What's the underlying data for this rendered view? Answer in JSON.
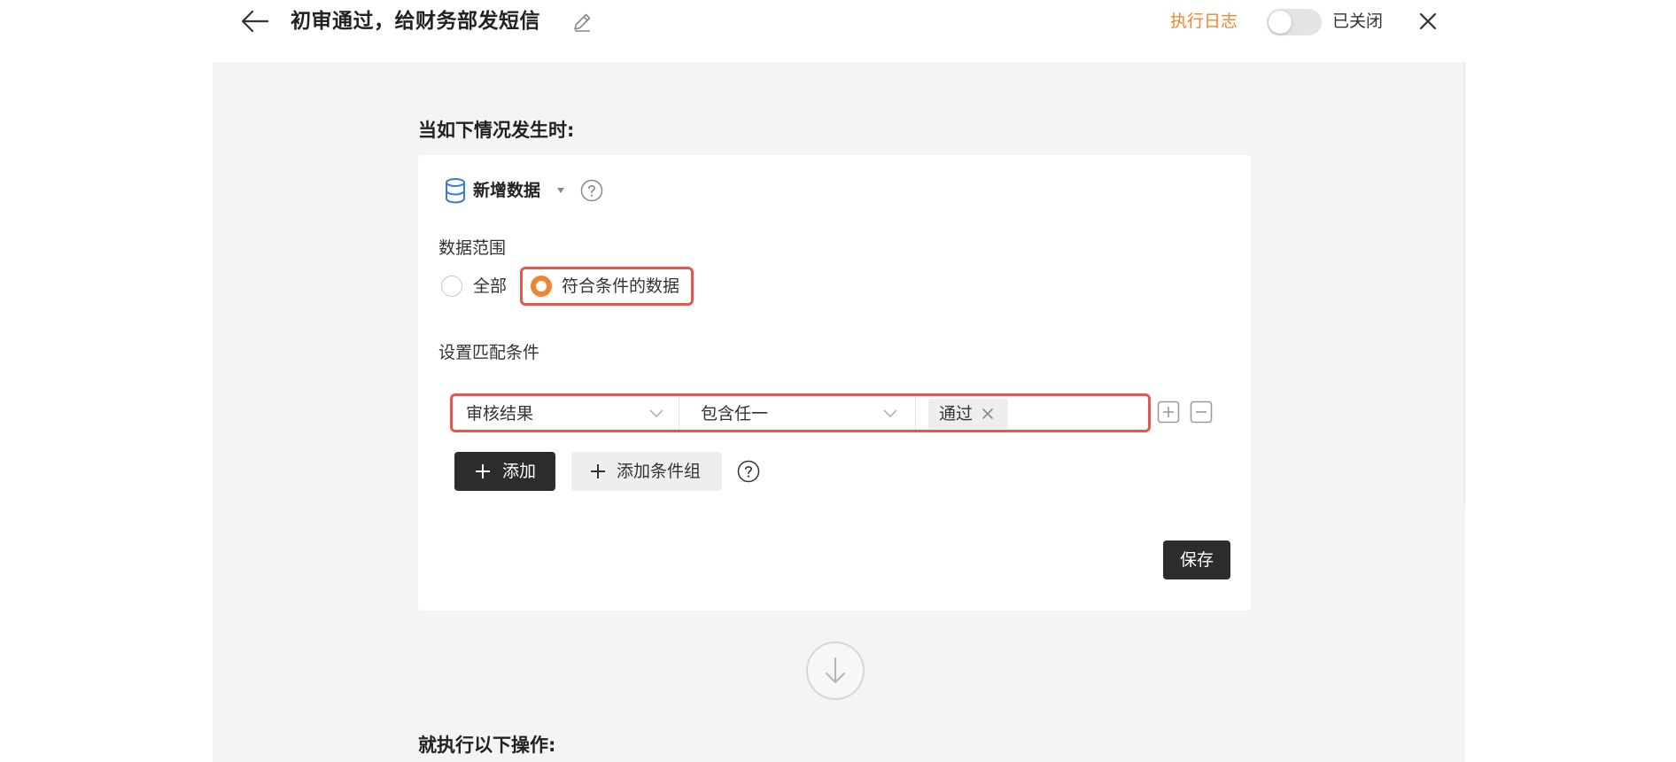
{
  "header": {
    "title": "初审通过，给财务部发短信",
    "log_link": "执行日志",
    "toggle_label": "已关闭",
    "toggle_on": false
  },
  "trigger": {
    "section_title": "当如下情况发生时:",
    "event": "新增数据",
    "scope_label": "数据范围",
    "scope_options": [
      "全部",
      "符合条件的数据"
    ],
    "scope_selected": "符合条件的数据",
    "match_label": "设置匹配条件",
    "condition": {
      "field": "审核结果",
      "operator": "包含任一",
      "values": [
        "通过"
      ]
    },
    "add_button": "添加",
    "add_group_button": "添加条件组",
    "save_button": "保存"
  },
  "action": {
    "section_title": "就执行以下操作:"
  },
  "colors": {
    "accent": "#f0852d",
    "highlight": "#e5574a",
    "dark_button": "#2c2c2c",
    "canvas_bg": "#f4f4f4",
    "db_icon": "#3a7bd5"
  },
  "icons": {
    "back": "arrow-left-icon",
    "edit": "pencil-icon",
    "close": "close-icon",
    "event": "database-icon",
    "help": "question-circle-icon",
    "add_condition": "plus-square-icon",
    "remove_condition": "minus-square-icon",
    "flow": "arrow-down-circle-icon"
  }
}
